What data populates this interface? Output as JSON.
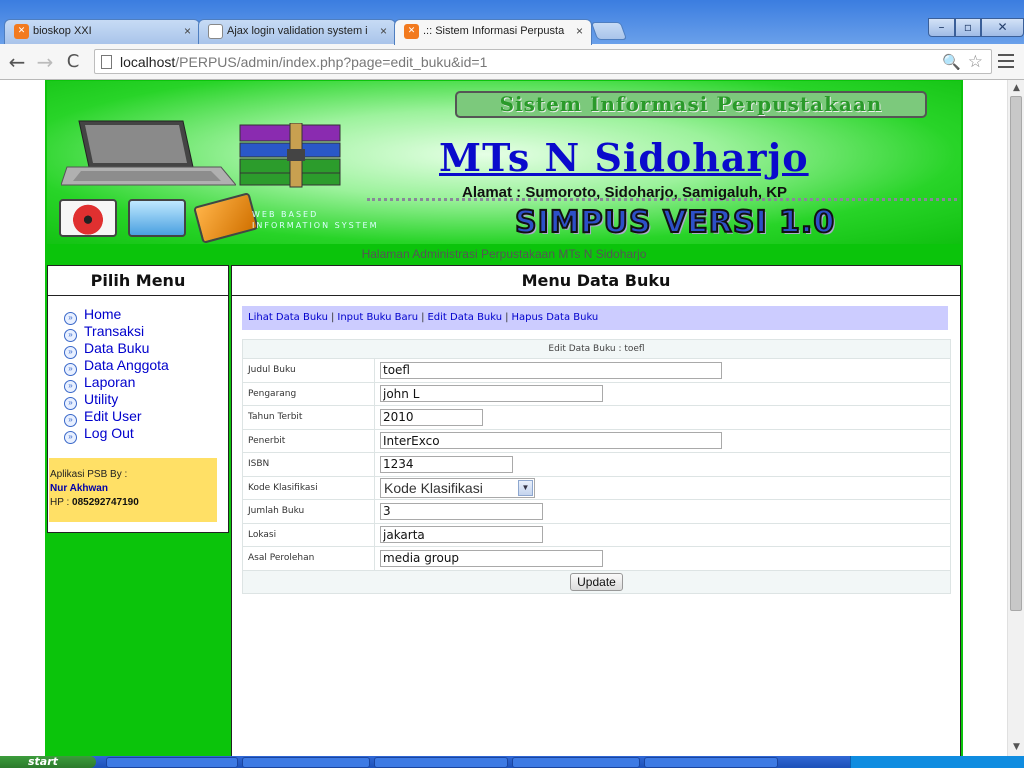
{
  "browser": {
    "tabs": [
      {
        "title": "bioskop XXI",
        "close": "×"
      },
      {
        "title": "Ajax login validation system i",
        "close": "×"
      },
      {
        "title": ".:: Sistem Informasi Perpusta",
        "close": "×"
      }
    ],
    "window_buttons": {
      "minimize": "–",
      "maximize": "▫",
      "close": "✕"
    },
    "nav": {
      "back": "←",
      "forward": "→",
      "reload": "C"
    },
    "url": {
      "host": "localhost",
      "path": "/PERPUS/admin/index.php?page=edit_buku&id=1"
    }
  },
  "banner": {
    "system_title": "Sistem Informasi Perpustakaan",
    "school": "MTs N Sidoharjo",
    "address": "Alamat : Sumoroto, Sidoharjo, Samigaluh, KP",
    "version": "SIMPUS VERSI 1.0",
    "webbased_line1": "WEB BASED",
    "webbased_line2": "INFORMATION SYSTEM"
  },
  "subtitle": "Halaman Administrasi Perpustakaan MTs N Sidoharjo",
  "left_menu": {
    "heading": "Pilih Menu",
    "items": [
      "Home",
      "Transaksi",
      "Data Buku",
      "Data Anggota",
      "Laporan",
      "Utility",
      "Edit User",
      "Log Out"
    ],
    "info": {
      "line1": "Aplikasi PSB By :",
      "name": "Nur Akhwan",
      "hp_label": "HP : ",
      "hp": "085292747190"
    }
  },
  "main": {
    "heading": "Menu Data Buku",
    "links": [
      "Lihat Data Buku",
      "Input Buku Baru",
      "Edit Data Buku",
      "Hapus Data Buku"
    ],
    "link_separator": "|",
    "form": {
      "caption": "Edit Data Buku : toefl",
      "fields": {
        "judul": {
          "label": "Judul Buku",
          "value": "toefl"
        },
        "pengarang": {
          "label": "Pengarang",
          "value": "john L"
        },
        "tahun": {
          "label": "Tahun Terbit",
          "value": "2010"
        },
        "penerbit": {
          "label": "Penerbit",
          "value": "InterExco"
        },
        "isbn": {
          "label": "ISBN",
          "value": "1234"
        },
        "kode": {
          "label": "Kode Klasifikasi",
          "value": "Kode Klasifikasi"
        },
        "jumlah": {
          "label": "Jumlah Buku",
          "value": "3"
        },
        "lokasi": {
          "label": "Lokasi",
          "value": "jakarta"
        },
        "asal": {
          "label": "Asal Perolehan",
          "value": "media group"
        }
      },
      "submit": "Update"
    }
  },
  "taskbar": {
    "start": "start"
  },
  "colors": {
    "page_green": "#0bc40b",
    "link_blue": "#0000cc",
    "linkbar_bg": "#ccccff",
    "info_bg": "#ffe066"
  }
}
